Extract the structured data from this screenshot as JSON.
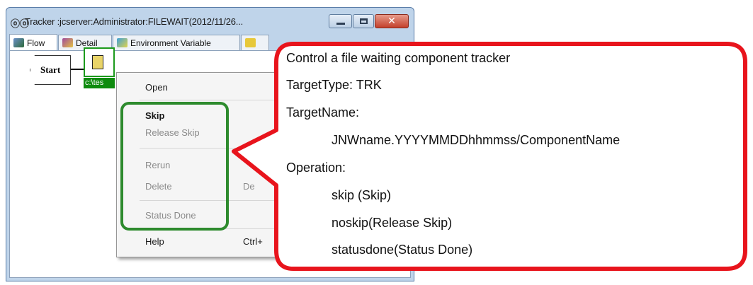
{
  "window": {
    "title": "Tracker :jcserver:Administrator:FILEWAIT(2012/11/26...",
    "app_icon": "binoculars-icon",
    "app_icon_glyph": "ⓞⓞ",
    "close_glyph": "✕"
  },
  "tabs": [
    {
      "label": "Flow",
      "icon": "flow-icon"
    },
    {
      "label": "Detail",
      "icon": "detail-icon"
    },
    {
      "label": "Environment Variable",
      "icon": "environment-variable-icon"
    },
    {
      "label": "",
      "icon": "tab-icon"
    }
  ],
  "flow": {
    "start_label": "Start",
    "component_label": "c:\\tes"
  },
  "menu": {
    "items": [
      {
        "label": "Open",
        "shortcut": "",
        "enabled": true
      },
      {
        "label": "Skip",
        "shortcut": "",
        "enabled": true
      },
      {
        "label": "Release Skip",
        "shortcut": "",
        "enabled": false
      },
      {
        "label": "Rerun",
        "shortcut": "",
        "enabled": false
      },
      {
        "label": "Delete",
        "shortcut": "De",
        "enabled": false
      },
      {
        "label": "Status Done",
        "shortcut": "",
        "enabled": false
      },
      {
        "label": "Help",
        "shortcut": "Ctrl+",
        "enabled": true
      }
    ]
  },
  "callout": {
    "lines": [
      "Control a file waiting component tracker",
      "TargetType: TRK",
      "TargetName:",
      "JNWname.YYYYMMDDhhmmss/ComponentName",
      "Operation:",
      "skip (Skip)",
      "noskip(Release Skip)",
      "statusdone(Status Done)"
    ]
  },
  "colors": {
    "callout_border": "#e8141c",
    "group_outline": "#2e8b2e",
    "component_green": "#0e8b0e"
  }
}
